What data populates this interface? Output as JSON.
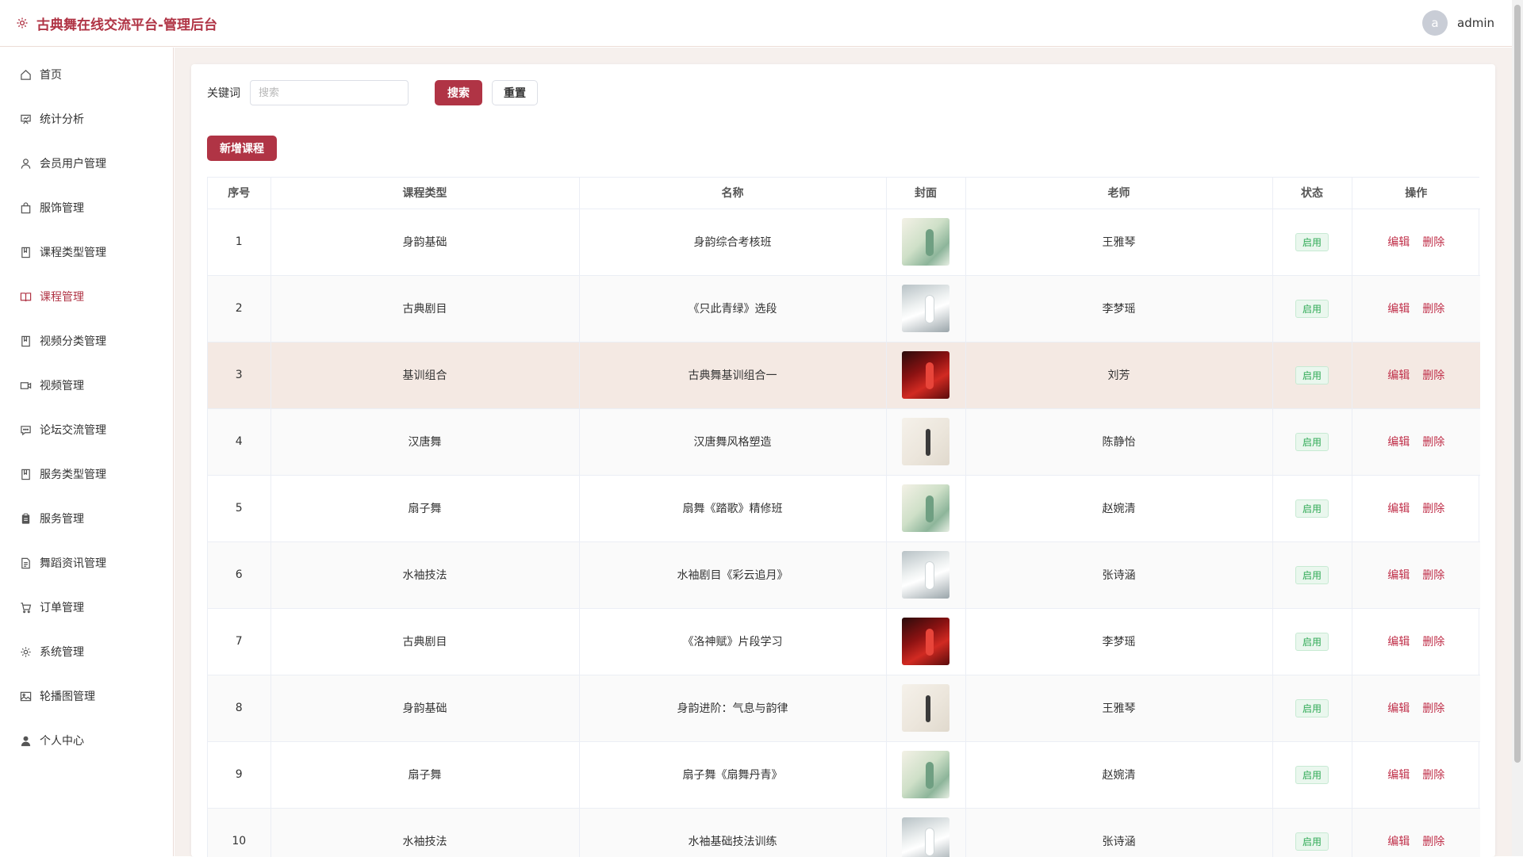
{
  "header": {
    "title": "古典舞在线交流平台-管理后台",
    "avatar_letter": "a",
    "username": "admin"
  },
  "sidebar": {
    "items": [
      {
        "label": "首页",
        "icon": "home-icon"
      },
      {
        "label": "统计分析",
        "icon": "chart-icon"
      },
      {
        "label": "会员用户管理",
        "icon": "user-icon"
      },
      {
        "label": "服饰管理",
        "icon": "bag-icon"
      },
      {
        "label": "课程类型管理",
        "icon": "book-icon"
      },
      {
        "label": "课程管理",
        "icon": "open-book-icon"
      },
      {
        "label": "视频分类管理",
        "icon": "book-icon"
      },
      {
        "label": "视频管理",
        "icon": "video-icon"
      },
      {
        "label": "论坛交流管理",
        "icon": "chat-icon"
      },
      {
        "label": "服务类型管理",
        "icon": "book-icon"
      },
      {
        "label": "服务管理",
        "icon": "clipboard-icon"
      },
      {
        "label": "舞蹈资讯管理",
        "icon": "document-icon"
      },
      {
        "label": "订单管理",
        "icon": "cart-icon"
      },
      {
        "label": "系统管理",
        "icon": "gear-icon"
      },
      {
        "label": "轮播图管理",
        "icon": "image-icon"
      },
      {
        "label": "个人中心",
        "icon": "person-icon"
      }
    ],
    "active_index": 5
  },
  "search": {
    "label": "关键词",
    "placeholder": "搜索",
    "value": "",
    "search_button": "搜索",
    "reset_button": "重置"
  },
  "add_button": "新增课程",
  "table": {
    "headers": [
      "序号",
      "课程类型",
      "名称",
      "封面",
      "老师",
      "状态",
      "操作"
    ],
    "edit_label": "编辑",
    "delete_label": "删除",
    "rows": [
      {
        "no": "1",
        "type": "身韵基础",
        "name": "身韵综合考核班",
        "cover": "green",
        "teacher": "王雅琴",
        "status": "启用"
      },
      {
        "no": "2",
        "type": "古典剧目",
        "name": "《只此青绿》选段",
        "cover": "grey",
        "teacher": "李梦瑶",
        "status": "启用"
      },
      {
        "no": "3",
        "type": "基训组合",
        "name": "古典舞基训组合一",
        "cover": "red",
        "teacher": "刘芳",
        "status": "启用"
      },
      {
        "no": "4",
        "type": "汉唐舞",
        "name": "汉唐舞风格塑造",
        "cover": "light",
        "teacher": "陈静怡",
        "status": "启用"
      },
      {
        "no": "5",
        "type": "扇子舞",
        "name": "扇舞《踏歌》精修班",
        "cover": "green",
        "teacher": "赵婉清",
        "status": "启用"
      },
      {
        "no": "6",
        "type": "水袖技法",
        "name": "水袖剧目《彩云追月》",
        "cover": "grey",
        "teacher": "张诗涵",
        "status": "启用"
      },
      {
        "no": "7",
        "type": "古典剧目",
        "name": "《洛神赋》片段学习",
        "cover": "red",
        "teacher": "李梦瑶",
        "status": "启用"
      },
      {
        "no": "8",
        "type": "身韵基础",
        "name": "身韵进阶：气息与韵律",
        "cover": "light",
        "teacher": "王雅琴",
        "status": "启用"
      },
      {
        "no": "9",
        "type": "扇子舞",
        "name": "扇子舞《扇舞丹青》",
        "cover": "green",
        "teacher": "赵婉清",
        "status": "启用"
      },
      {
        "no": "10",
        "type": "水袖技法",
        "name": "水袖基础技法训练",
        "cover": "grey",
        "teacher": "张诗涵",
        "status": "启用"
      }
    ]
  },
  "colors": {
    "brand": "#b03445",
    "status_green": "#2faa55",
    "row_highlight": "#f4e9e3"
  }
}
